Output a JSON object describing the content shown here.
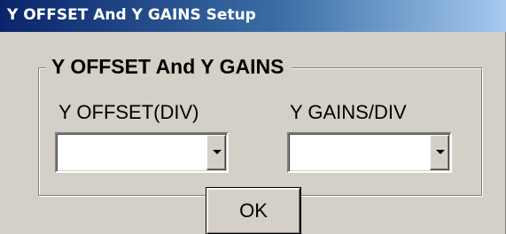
{
  "window": {
    "title": "Y OFFSET And Y GAINS Setup"
  },
  "group": {
    "legend": "Y OFFSET And Y GAINS"
  },
  "fields": {
    "offset": {
      "label": "Y OFFSET(DIV)",
      "value": ""
    },
    "gains": {
      "label": "Y GAINS/DIV",
      "value": ""
    }
  },
  "buttons": {
    "ok_label": "OK"
  },
  "icons": {
    "dropdown": "chevron-down-icon"
  },
  "colors": {
    "title_bar_start": "#0a246a",
    "title_bar_end": "#a6caf0",
    "dialog_face": "#d4d0c8"
  }
}
